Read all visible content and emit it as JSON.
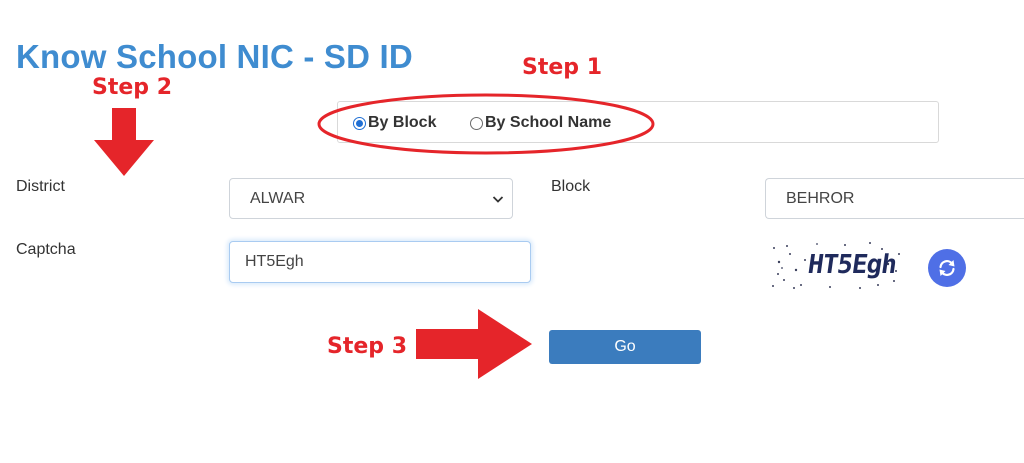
{
  "page": {
    "title": "Know School NIC - SD ID"
  },
  "annotations": {
    "step1": "Step 1",
    "step2": "Step 2",
    "step3": "Step 3"
  },
  "search_mode": {
    "options": [
      {
        "label": "By Block",
        "selected": true
      },
      {
        "label": "By School Name",
        "selected": false
      }
    ]
  },
  "form": {
    "district_label": "District",
    "district_value": "ALWAR",
    "block_label": "Block",
    "block_value": "BEHROR",
    "captcha_label": "Captcha",
    "captcha_value": "HT5Egh",
    "captcha_image_text": "HT5Egh",
    "go_label": "Go"
  },
  "colors": {
    "title": "#3f8cd0",
    "annotation_red": "#e5252a",
    "button": "#3b7cbe",
    "refresh": "#4f6fe6"
  },
  "icons": [
    "chevron-down-icon",
    "refresh-icon",
    "arrow-down-icon",
    "arrow-right-icon"
  ]
}
